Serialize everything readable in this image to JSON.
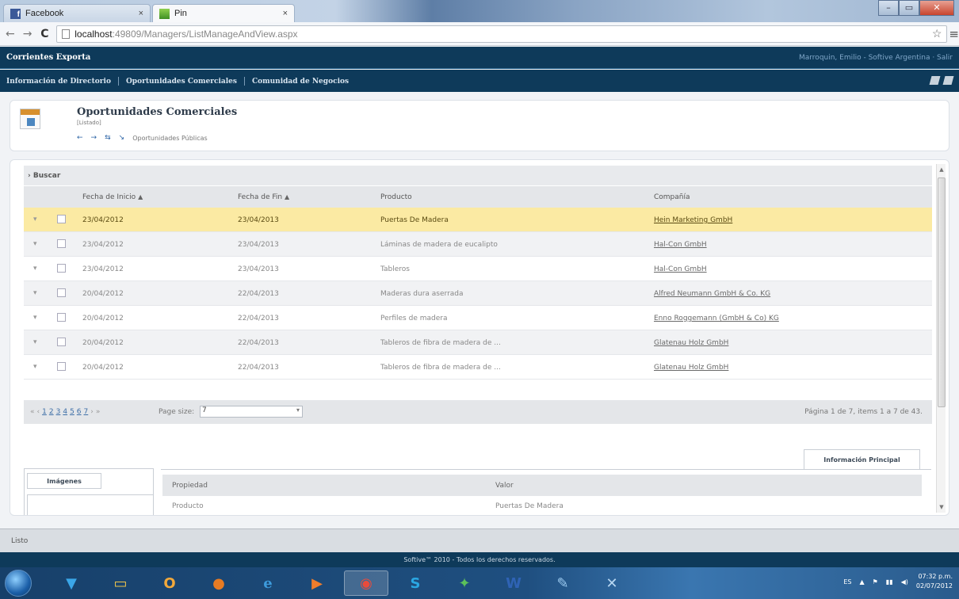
{
  "browser": {
    "tabs": [
      {
        "title": "Facebook"
      },
      {
        "title": "Pin"
      }
    ],
    "url_host": "localhost",
    "url_path": ":49809/Managers/ListManageAndView.aspx"
  },
  "app": {
    "name": "Corrientes Exporta",
    "user": "Marroquin, Emilio - Softive Argentina · Salir",
    "nav": [
      "Información de Directorio",
      "Oportunidades Comerciales",
      "Comunidad de Negocios"
    ]
  },
  "page": {
    "title": "Oportunidades Comerciales",
    "subtitle": "[Listado]",
    "nav_link": "Oportunidades Públicas"
  },
  "grid": {
    "search_label": "Buscar",
    "columns": [
      "Fecha de Inicio",
      "Fecha de Fin",
      "Producto",
      "Compañía"
    ],
    "rows": [
      {
        "start": "23/04/2012",
        "end": "23/04/2013",
        "product": "Puertas De Madera",
        "company": "Hein Marketing GmbH"
      },
      {
        "start": "23/04/2012",
        "end": "23/04/2013",
        "product": "Láminas de madera de eucalipto",
        "company": "Hal-Con GmbH"
      },
      {
        "start": "23/04/2012",
        "end": "23/04/2013",
        "product": "Tableros",
        "company": "Hal-Con GmbH"
      },
      {
        "start": "20/04/2012",
        "end": "22/04/2013",
        "product": "Maderas dura aserrada",
        "company": "Alfred Neumann GmbH & Co. KG"
      },
      {
        "start": "20/04/2012",
        "end": "22/04/2013",
        "product": "Perfiles de madera",
        "company": "Enno Roggemann (GmbH & Co) KG"
      },
      {
        "start": "20/04/2012",
        "end": "22/04/2013",
        "product": "Tableros de fibra de madera de ...",
        "company": "Glatenau Holz GmbH"
      },
      {
        "start": "20/04/2012",
        "end": "22/04/2013",
        "product": "Tableros de fibra de madera de ...",
        "company": "Glatenau Holz GmbH"
      }
    ],
    "selected_row": 0,
    "pager": {
      "pages": [
        "1",
        "2",
        "3",
        "4",
        "5",
        "6",
        "7"
      ],
      "page_size_label": "Page size:",
      "page_size": "7",
      "info": "Página 1 de 7, items 1 a 7 de 43."
    }
  },
  "details": {
    "tab_main": "Información Principal",
    "tab_images": "Imágenes",
    "columns": [
      "Propiedad",
      "Valor"
    ],
    "row": {
      "property": "Producto",
      "value": "Puertas De Madera"
    }
  },
  "status": "Listo",
  "footer": "Softive™ 2010 - Todos los derechos reservados.",
  "taskbar": {
    "lang": "ES",
    "time": "07:32 p.m.",
    "date": "02/07/2012"
  },
  "colors": {
    "header_bg": "#0e3a5a",
    "selected_row": "#fbeaa3",
    "link": "#3e6fa7"
  }
}
